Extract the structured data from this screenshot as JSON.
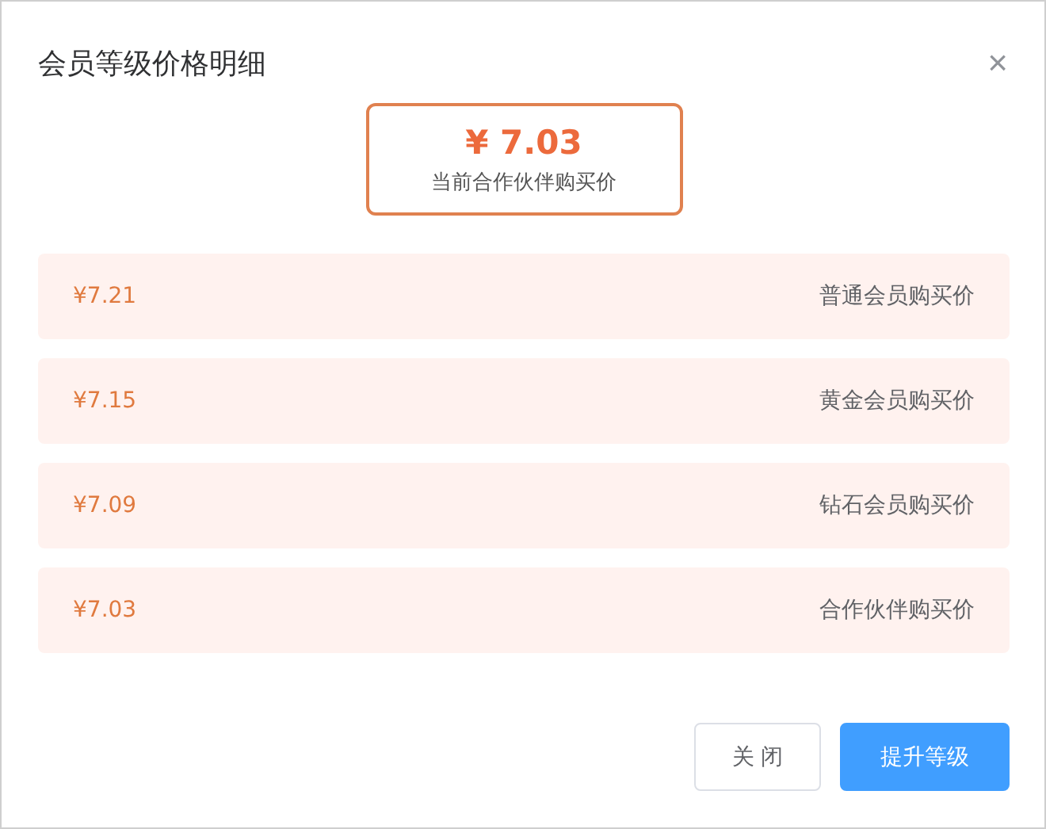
{
  "dialog": {
    "title": "会员等级价格明细",
    "close": "×"
  },
  "current": {
    "price": "¥ 7.03",
    "label": "当前合作伙伴购买价"
  },
  "levels": [
    {
      "price": "¥7.21",
      "name": "普通会员购买价"
    },
    {
      "price": "¥7.15",
      "name": "黄金会员购买价"
    },
    {
      "price": "¥7.09",
      "name": "钻石会员购买价"
    },
    {
      "price": "¥7.03",
      "name": "合作伙伴购买价"
    }
  ],
  "buttons": [
    {
      "label": "关 闭",
      "kind": "plain"
    },
    {
      "label": "提升等级",
      "kind": "primary"
    }
  ]
}
